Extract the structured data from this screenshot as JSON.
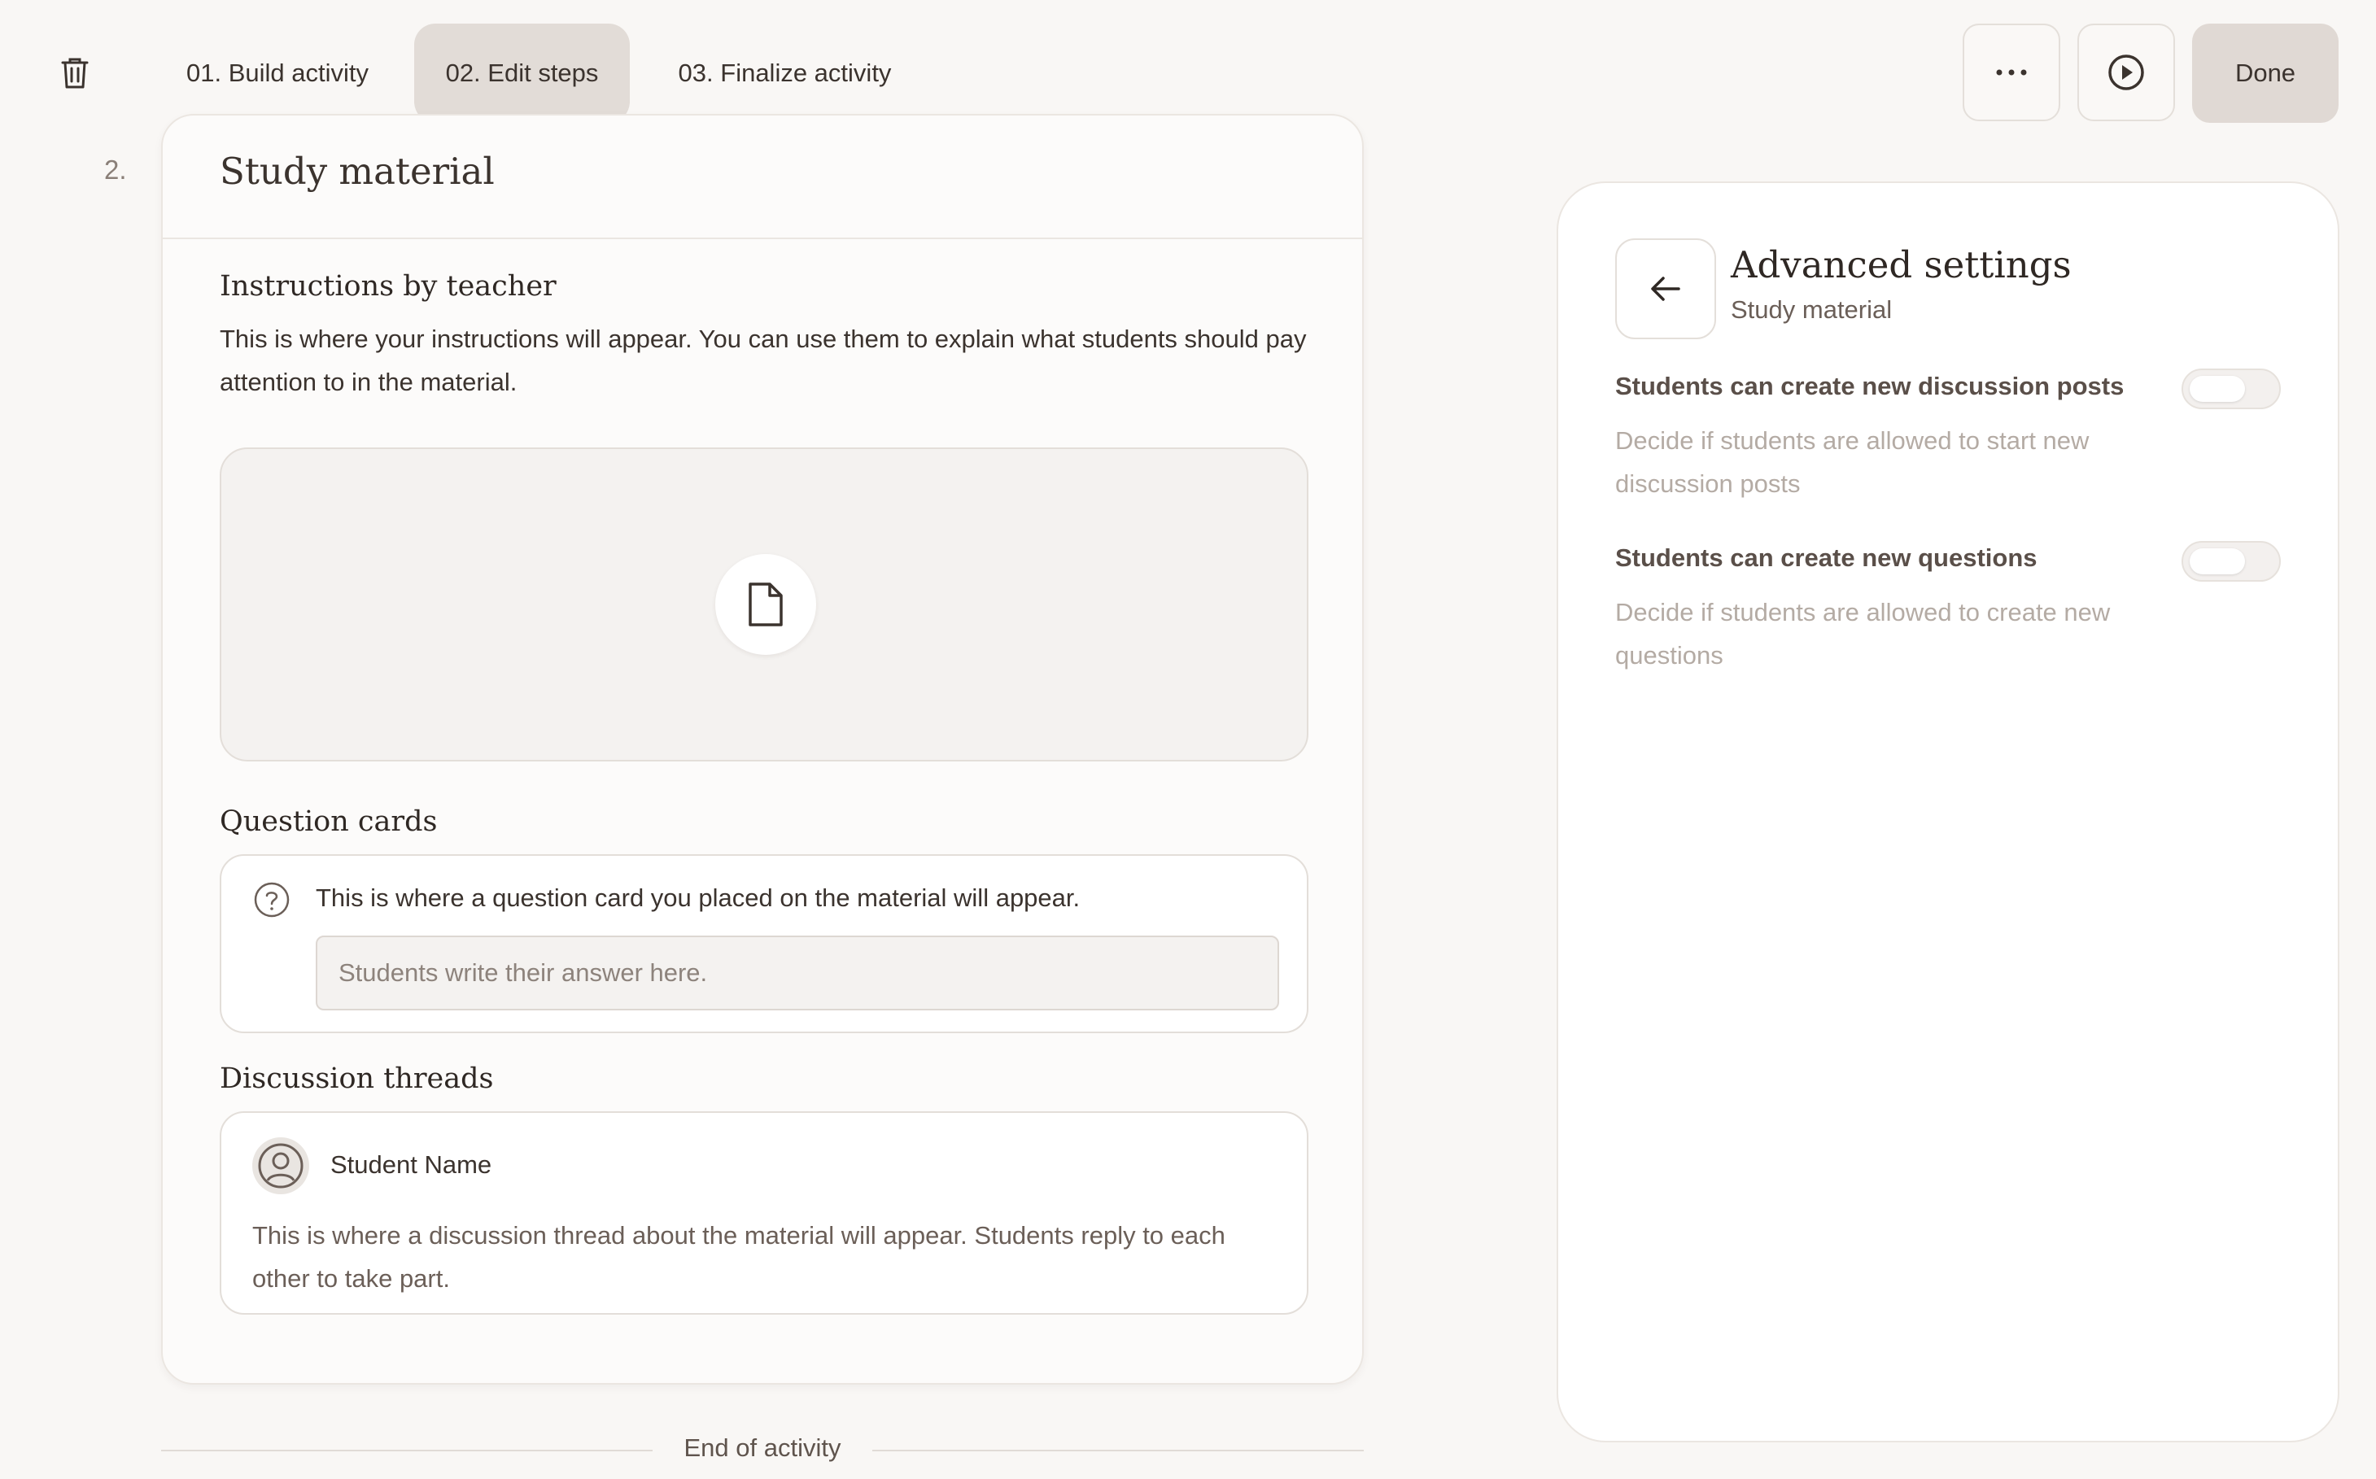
{
  "header": {
    "tabs": [
      {
        "label": "01. Build activity",
        "active": false
      },
      {
        "label": "02. Edit steps",
        "active": true
      },
      {
        "label": "03. Finalize activity",
        "active": false
      }
    ],
    "done_label": "Done",
    "icons": [
      "trash-icon",
      "more-icon",
      "play-icon"
    ]
  },
  "step": {
    "number": "2.",
    "title": "Study material",
    "instructions_heading": "Instructions by teacher",
    "instructions_text": "This is where your instructions will appear. You can use them to explain what students should pay attention to in the material.",
    "material_icon": "file-icon",
    "question_cards_heading": "Question cards",
    "question_text": "This is where a question card you placed on the material will appear.",
    "answer_placeholder": "Students write their answer here.",
    "discussion_heading": "Discussion threads",
    "student_name": "Student Name",
    "discussion_text": "This is where a discussion thread about the material will appear. Students reply to each other to take part."
  },
  "end_label": "End of activity",
  "advanced": {
    "title": "Advanced settings",
    "subtitle": "Study material",
    "settings": [
      {
        "label": "Students can create new discussion posts",
        "description": "Decide if students are allowed to start new discussion posts",
        "enabled": false
      },
      {
        "label": "Students can create new questions",
        "description": "Decide if students are allowed to create new questions",
        "enabled": false
      }
    ]
  },
  "colors": {
    "background": "#f9f7f5",
    "active_tab": "#e2dcd7",
    "done_button": "#e0d9d4",
    "text": "#3b332e",
    "muted_text": "#b4aba4"
  }
}
